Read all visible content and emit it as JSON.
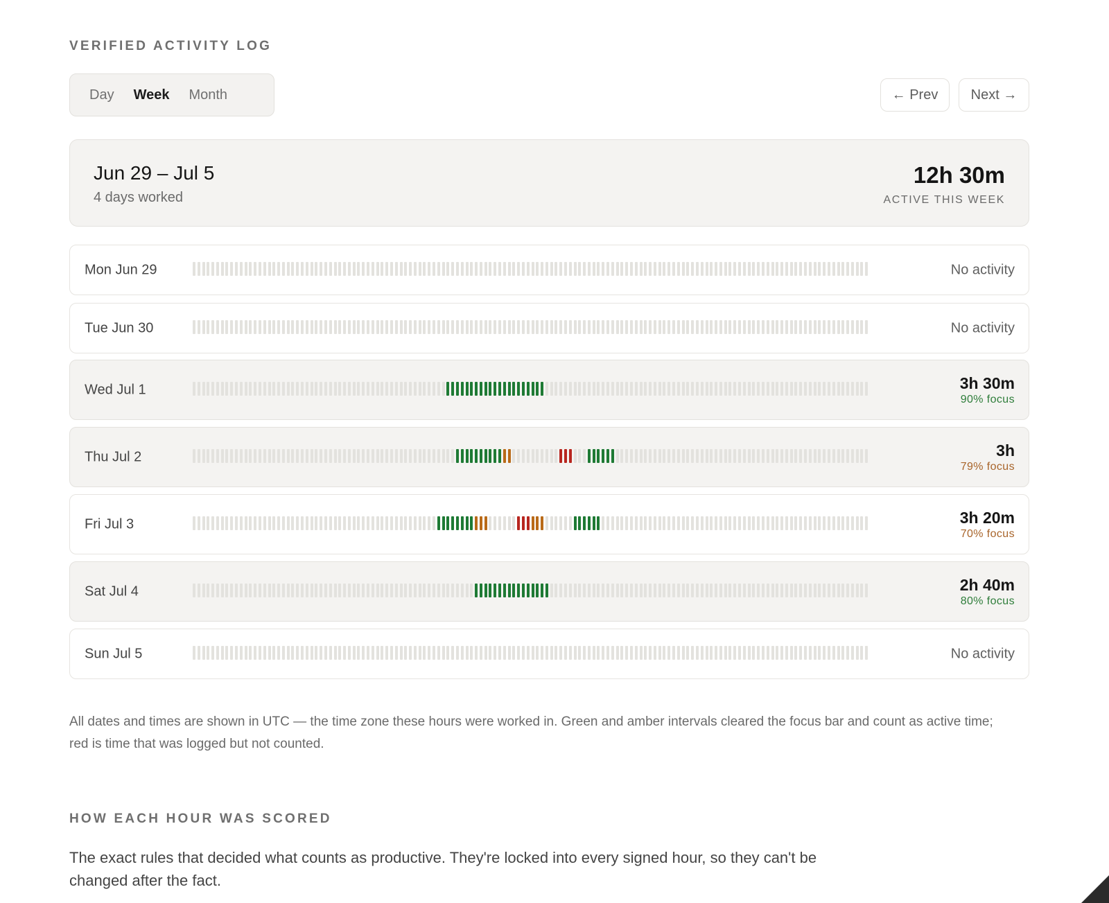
{
  "header": {
    "title": "VERIFIED ACTIVITY LOG"
  },
  "tabs": [
    {
      "label": "Day",
      "active": false
    },
    {
      "label": "Week",
      "active": true
    },
    {
      "label": "Month",
      "active": false
    }
  ],
  "nav": {
    "prev_label": "← Prev",
    "next_label": "Next →"
  },
  "summary": {
    "range": "Jun 29 – Jul 5",
    "days_worked": "4 days worked",
    "total": "12h 30m",
    "total_label": "ACTIVE THIS WEEK"
  },
  "colors": {
    "empty": "#e3e2de",
    "green": "#1e7a34",
    "amber": "#b96a18",
    "red": "#b8261f",
    "focus_green": "#2e7d3a",
    "focus_amber": "#a8642a"
  },
  "timeline": {
    "slots_per_day": 144
  },
  "days": [
    {
      "label": "Mon Jun 29",
      "worked": false,
      "status": "No activity",
      "segments": []
    },
    {
      "label": "Tue Jun 30",
      "worked": false,
      "status": "No activity",
      "segments": []
    },
    {
      "label": "Wed Jul 1",
      "worked": true,
      "duration": "3h 30m",
      "focus": "90% focus",
      "focus_level": "green",
      "segments": [
        {
          "from": 54,
          "count": 21,
          "color": "green"
        }
      ]
    },
    {
      "label": "Thu Jul 2",
      "worked": true,
      "duration": "3h",
      "focus": "79% focus",
      "focus_level": "amber",
      "segments": [
        {
          "from": 56,
          "count": 10,
          "color": "green"
        },
        {
          "from": 66,
          "count": 2,
          "color": "amber"
        },
        {
          "from": 78,
          "count": 3,
          "color": "red"
        },
        {
          "from": 84,
          "count": 6,
          "color": "green"
        }
      ]
    },
    {
      "label": "Fri Jul 3",
      "worked": false,
      "duration": "3h 20m",
      "focus": "70% focus",
      "focus_level": "amber",
      "segments": [
        {
          "from": 52,
          "count": 8,
          "color": "green"
        },
        {
          "from": 60,
          "count": 3,
          "color": "amber"
        },
        {
          "from": 69,
          "count": 3,
          "color": "red"
        },
        {
          "from": 72,
          "count": 3,
          "color": "amber"
        },
        {
          "from": 81,
          "count": 6,
          "color": "green"
        }
      ]
    },
    {
      "label": "Sat Jul 4",
      "worked": true,
      "duration": "2h 40m",
      "focus": "80% focus",
      "focus_level": "green",
      "segments": [
        {
          "from": 60,
          "count": 16,
          "color": "green"
        }
      ]
    },
    {
      "label": "Sun Jul 5",
      "worked": false,
      "status": "No activity",
      "segments": []
    }
  ],
  "footnote": "All dates and times are shown in UTC — the time zone these hours were worked in. Green and amber intervals cleared the focus bar and count as active time; red is time that was logged but not counted.",
  "scoring": {
    "title": "HOW EACH HOUR WAS SCORED",
    "intro": "The exact rules that decided what counts as productive. They're locked into every signed hour, so they can't be changed after the fact."
  }
}
